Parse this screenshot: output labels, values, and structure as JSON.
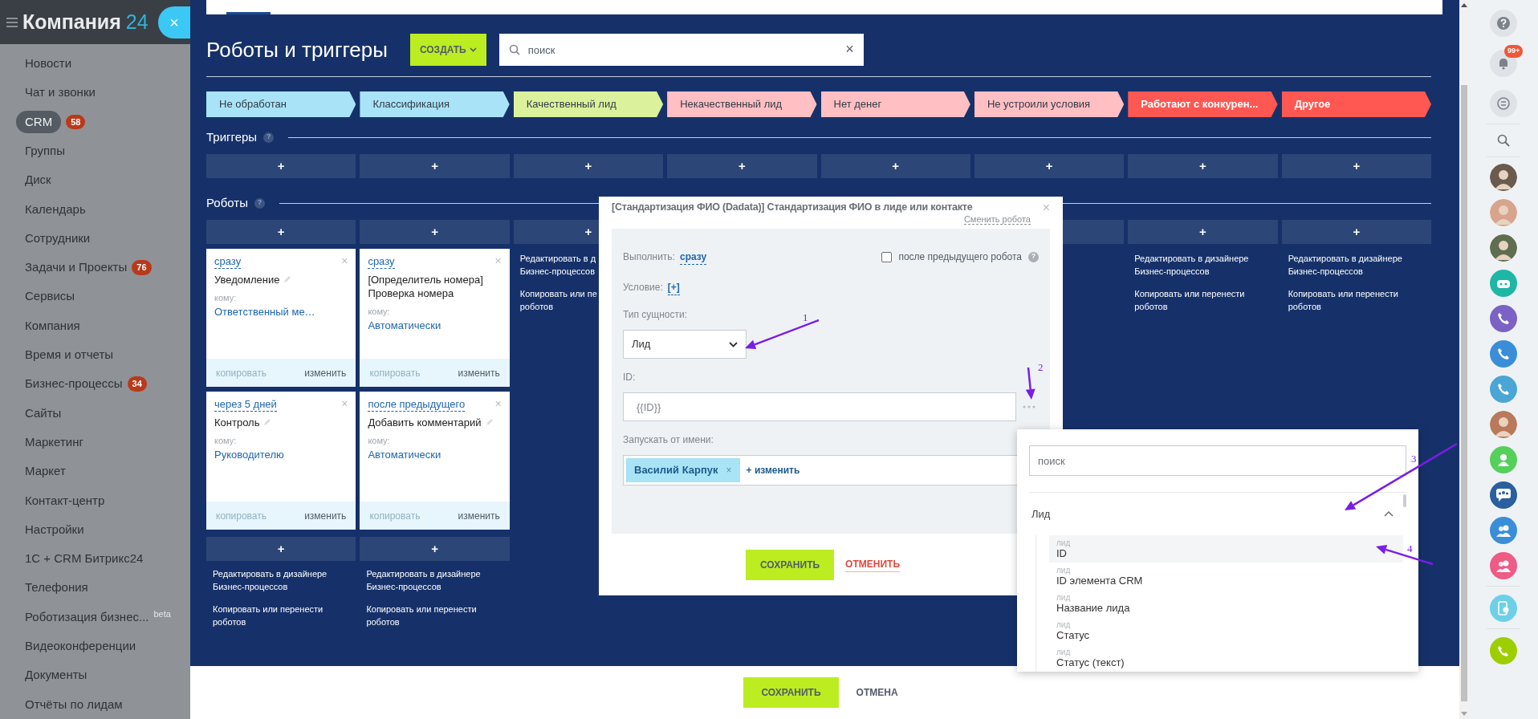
{
  "sidebar": {
    "logo": {
      "name": "Компания",
      "number": "24"
    },
    "close": "×",
    "items": [
      {
        "label": "Новости",
        "selected": false
      },
      {
        "label": "Чат и звонки",
        "selected": false
      },
      {
        "label": "CRM",
        "selected": true,
        "badge": "58"
      },
      {
        "label": "Группы",
        "selected": false
      },
      {
        "label": "Диск",
        "selected": false
      },
      {
        "label": "Календарь",
        "selected": false
      },
      {
        "label": "Сотрудники",
        "selected": false
      },
      {
        "label": "Задачи и Проекты",
        "selected": false,
        "badge": "76"
      },
      {
        "label": "Сервисы",
        "selected": false
      },
      {
        "label": "Компания",
        "selected": false
      },
      {
        "label": "Время и отчеты",
        "selected": false
      },
      {
        "label": "Бизнес-процессы",
        "selected": false,
        "badge": "34"
      },
      {
        "label": "Сайты",
        "selected": false
      },
      {
        "label": "Маркетинг",
        "selected": false
      },
      {
        "label": "Маркет",
        "selected": false
      },
      {
        "label": "Контакт-центр",
        "selected": false
      },
      {
        "label": "Настройки",
        "selected": false
      },
      {
        "label": "1С + CRM Битрикс24",
        "selected": false
      },
      {
        "label": "Телефония",
        "selected": false
      },
      {
        "label": "Роботизация бизнес...",
        "selected": false,
        "tag": "beta"
      },
      {
        "label": "Видеоконференции",
        "selected": false
      },
      {
        "label": "Документы",
        "selected": false
      },
      {
        "label": "Отчёты по лидам",
        "selected": false
      }
    ]
  },
  "page": {
    "title": "Роботы и триггеры",
    "create_button": "СОЗДАТЬ",
    "search": {
      "placeholder": "поиск",
      "clear": "×"
    }
  },
  "stages": [
    {
      "label": "Не обработан",
      "color": "#a9e3f7"
    },
    {
      "label": "Классификация",
      "color": "#a9e3f7"
    },
    {
      "label": "Качественный лид",
      "color": "#dbf19b"
    },
    {
      "label": "Некачественный лид",
      "color": "#ffbfc3"
    },
    {
      "label": "Нет денег",
      "color": "#ffbfc3"
    },
    {
      "label": "Не устроили условия",
      "color": "#ffbfc3"
    },
    {
      "label": "Работают с конкурен...",
      "color": "#ff5752"
    },
    {
      "label": "Другое",
      "color": "#ff5752"
    }
  ],
  "triggers": {
    "title": "Триггеры",
    "help": "?",
    "add": [
      "+",
      "+",
      "+",
      "+",
      "+",
      "+",
      "+",
      "+"
    ]
  },
  "robots": {
    "title": "Роботы",
    "help": "?",
    "columns": [
      {
        "add": "+",
        "cards": [
          {
            "delay": "сразу",
            "close": "×",
            "title": "Уведомление",
            "editable": true,
            "to_label": "кому:",
            "to": "Ответственный ме…",
            "copy": {
              "label": "копировать",
              "disabled": true
            },
            "edit": "изменить"
          },
          {
            "delay": "через 5 дней",
            "close": "×",
            "title": "Контроль",
            "editable": true,
            "to_label": "кому:",
            "to": "Руководителю",
            "copy": {
              "label": "копировать",
              "disabled": true
            },
            "edit": "изменить"
          }
        ],
        "bottom_add": "+",
        "links": [
          {
            "lines": [
              "Редактировать в дизайнере",
              "Бизнес-процессов"
            ]
          },
          {
            "lines": [
              "Копировать или перенести",
              "роботов"
            ]
          }
        ]
      },
      {
        "add": "+",
        "cards": [
          {
            "delay": "сразу",
            "close": "×",
            "title": "[Определитель номера] Проверка номера",
            "editable": false,
            "to_label": "кому:",
            "to": "Автоматически",
            "copy": {
              "label": "копировать",
              "disabled": true
            },
            "edit": "изменить"
          },
          {
            "delay": "после предыдущего",
            "close": "×",
            "title": "Добавить комментарий",
            "editable": true,
            "to_label": "кому:",
            "to": "Автоматически",
            "copy": {
              "label": "копировать",
              "disabled": true
            },
            "edit": "изменить"
          }
        ],
        "bottom_add": "+",
        "links": [
          {
            "lines": [
              "Редактировать в дизайнере",
              "Бизнес-процессов"
            ]
          },
          {
            "lines": [
              "Копировать или перенести",
              "роботов"
            ]
          }
        ]
      },
      {
        "add": "+",
        "links": [
          {
            "lines": [
              "Редактировать в д",
              "Бизнес-процессов"
            ]
          },
          {
            "lines": [
              "Копировать или пе",
              "роботов"
            ]
          }
        ]
      },
      {},
      {},
      {
        "bar": true
      },
      {
        "add": "+",
        "links": [
          {
            "lines": [
              "Редактировать в дизайнере",
              "Бизнес-процессов"
            ]
          },
          {
            "lines": [
              "Копировать или перенести",
              "роботов"
            ]
          }
        ]
      },
      {
        "add": "+",
        "links": [
          {
            "lines": [
              "Редактировать в дизайнере",
              "Бизнес-процессов"
            ]
          },
          {
            "lines": [
              "Копировать или перенести",
              "роботов"
            ]
          }
        ]
      }
    ]
  },
  "modal": {
    "title": "[Стандартизация ФИО (Dadata)] Стандартизация ФИО в лиде или контакте",
    "change_link": "Сменить робота",
    "close": "×",
    "run_label": "Выполнить:",
    "run_value": "сразу",
    "after_previous": {
      "label": "после предыдущего робота",
      "checked": false
    },
    "help": "?",
    "condition_label": "Условие:",
    "condition_value": "[+]",
    "entity_label": "Тип сущности:",
    "entity_value": "Лид",
    "id_label": "ID:",
    "id_value": "{{ID}}",
    "run_as_label": "Запускать от имени:",
    "run_as_user": "Василий Карпук",
    "remove": "×",
    "change": "+ изменить",
    "save": "СОХРАНИТЬ",
    "cancel": "ОТМЕНИТЬ"
  },
  "field_picker": {
    "search_placeholder": "поиск",
    "group": {
      "label": "Лид",
      "expanded": true,
      "items": [
        {
          "source": "лид",
          "label": "ID",
          "selected": true
        },
        {
          "source": "лид",
          "label": "ID элемента CRM",
          "selected": false
        },
        {
          "source": "лид",
          "label": "Название лида",
          "selected": false
        },
        {
          "source": "лид",
          "label": "Статус",
          "selected": false
        },
        {
          "source": "лид",
          "label": "Статус (текст)",
          "selected": false
        }
      ]
    }
  },
  "annotations": [
    "1",
    "2",
    "3",
    "4"
  ],
  "footer": {
    "save": "СОХРАНИТЬ",
    "cancel": "ОТМЕНА"
  },
  "right_panel": {
    "notifications_badge": "99+",
    "contacts": [
      {
        "kind": "avatar",
        "color": "#6b5a4e"
      },
      {
        "kind": "avatar",
        "color": "#d9a48c"
      },
      {
        "kind": "avatar",
        "color": "#5f6e4e"
      },
      {
        "kind": "bot",
        "color": "#1eb7a6"
      },
      {
        "kind": "viber",
        "color": "#7b62c5"
      },
      {
        "kind": "phone",
        "color": "#3a8ed8"
      },
      {
        "kind": "phone",
        "color": "#4ba6d6"
      },
      {
        "kind": "avatar",
        "color": "#b9795a"
      },
      {
        "kind": "user",
        "color": "#55d05a"
      },
      {
        "kind": "chat",
        "color": "#2a5fa0"
      },
      {
        "kind": "group",
        "color": "#3a8ed8"
      },
      {
        "kind": "group",
        "color": "#ee5b85"
      }
    ]
  }
}
